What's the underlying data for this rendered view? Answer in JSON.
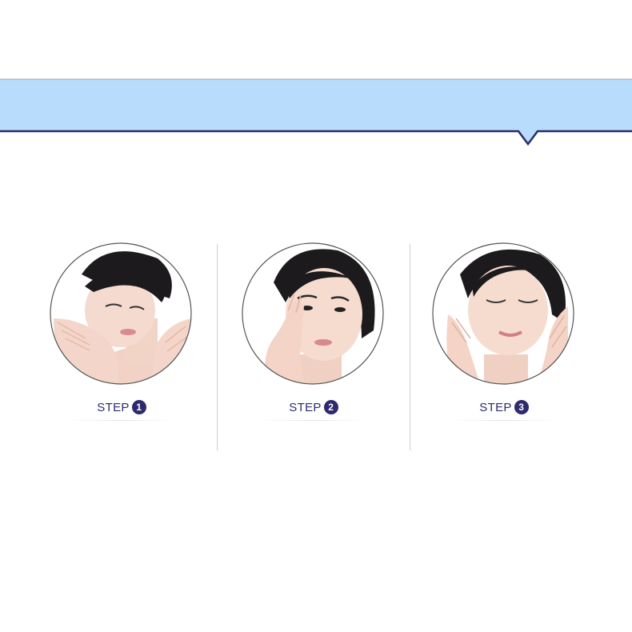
{
  "colors": {
    "banner_fill": "#b8dcfb",
    "banner_stroke": "#2c2a6b",
    "label_text": "#2d2a6e",
    "divider": "#cfcfcf"
  },
  "steps": [
    {
      "label": "STEP",
      "number": "1",
      "illustration": "woman-splashing-water-on-face"
    },
    {
      "label": "STEP",
      "number": "2",
      "illustration": "woman-massaging-nose"
    },
    {
      "label": "STEP",
      "number": "3",
      "illustration": "woman-patting-cheeks"
    }
  ]
}
